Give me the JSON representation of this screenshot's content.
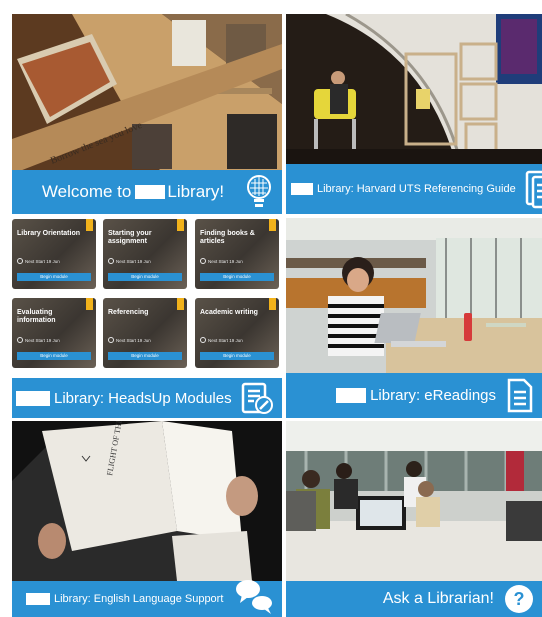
{
  "tiles": {
    "welcome": {
      "label": "Library!",
      "prefix": "Welcome to"
    },
    "harvard": {
      "label": "Library: Harvard UTS Referencing Guide"
    },
    "headsup": {
      "label": "Library: HeadsUp Modules"
    },
    "ereadings": {
      "label": "Library: eReadings"
    },
    "english": {
      "label": "Library: English Language Support"
    },
    "ask": {
      "label": "Ask a Librarian!"
    }
  },
  "modules": [
    {
      "title": "Library Orientation",
      "meta": "Next Start 19 Jun",
      "button": "Begin module"
    },
    {
      "title": "Starting your assignment",
      "meta": "Next Start 19 Jun",
      "button": "Begin module"
    },
    {
      "title": "Finding books & articles",
      "meta": "Next Start 19 Jun",
      "button": "Begin module"
    },
    {
      "title": "Evaluating information",
      "meta": "Next Start 19 Jun",
      "button": "Begin module"
    },
    {
      "title": "Referencing",
      "meta": "Next Start 19 Jun",
      "button": "Begin module"
    },
    {
      "title": "Academic writing",
      "meta": "Next Start 19 Jun",
      "button": "Begin module"
    }
  ],
  "photo_captions": {
    "shelf_text": "Borrow the sea you love",
    "book_title": "FLIGHT OF THE EAGLE"
  },
  "colors": {
    "banner_blue": "#2a91d3",
    "module_flag": "#f2b21b"
  },
  "icons": {
    "welcome": "lightbulb-icon",
    "harvard": "document-lines-icon",
    "headsup": "edit-document-icon",
    "ereadings": "document-text-icon",
    "english": "speech-bubbles-icon",
    "ask": "question-circle-icon"
  }
}
